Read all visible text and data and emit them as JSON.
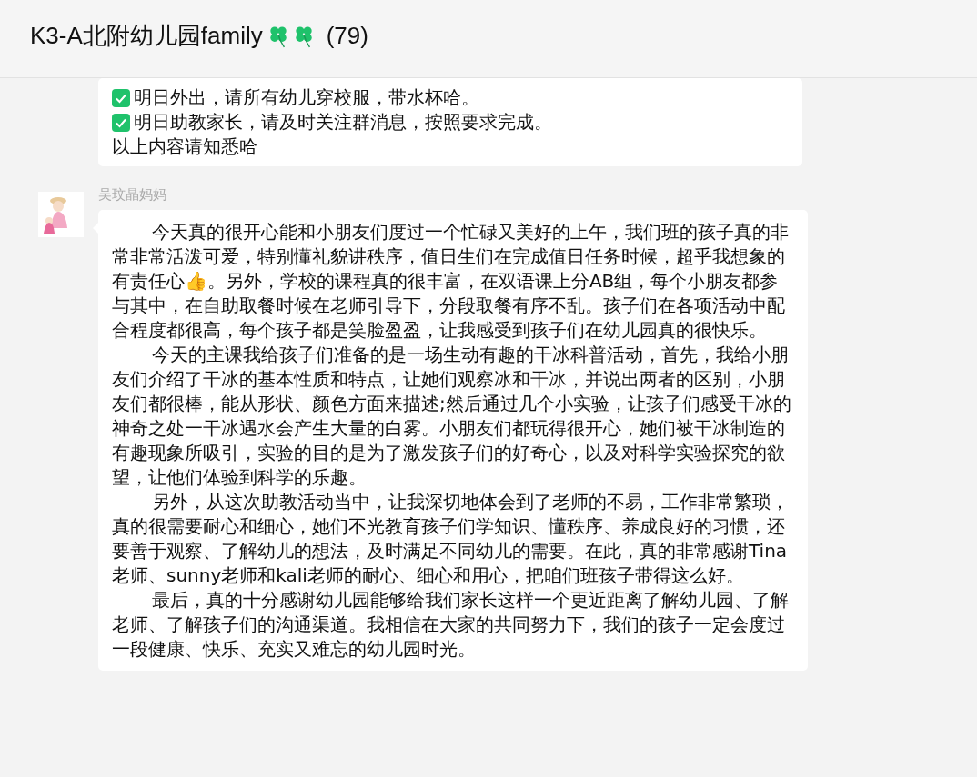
{
  "window": {
    "title": "K3-A北附幼儿园family",
    "count": "(79)"
  },
  "messages": [
    {
      "kind": "checklist",
      "lines": [
        {
          "checked": true,
          "text": "明日外出，请所有幼儿穿校服，带水杯哈。"
        },
        {
          "checked": true,
          "text": "明日助教家长，请及时关注群消息，按照要求完成。"
        }
      ],
      "footer": "以上内容请知悉哈"
    },
    {
      "kind": "paragraphs",
      "sender": "吴玟晶妈妈",
      "paragraphs": [
        {
          "parts": [
            "今天真的很开心能和小朋友们度过一个忙碌又美好的上午，我们班的孩子真的非常非常活泼可爱，特别懂礼貌讲秩序，值日生们在完成值日任务时候，超乎我想象的有责任心👍。另外，学校的课程真的很丰富，在双语课上分AB组，每个小朋友都参与其中，在自助取餐时候在老师引导下，分段取餐有序不乱。孩子们在各项活动中配合程度都很高，每个孩子都是笑脸盈盈，让我感受到孩子们在幼儿园真的很快乐。"
          ]
        },
        {
          "parts": [
            "今天的主课我给孩子们准备的是一场生动有趣的干冰科普活动，首先，我给小朋友们介绍了干冰的基本性质和特点，让她们观察冰和干冰，并说出两者的区别，小朋友们都很棒，能从形状、颜色方面来描述;然后通过几个小实验，让孩子们感受干冰的神奇之处一干冰遇水会产生大量的白雾。小朋友们都玩得很开心，她们被干冰制造的有趣现象所吸引，实验的目的是为了激发孩子们的好奇心，以及对科学实验探究的欲望，让他们体验到科学的乐趣。"
          ]
        },
        {
          "parts": [
            "另外，从这次助教活动当中，让我深切地体会到了老师的不易，工作非常繁琐，真的很需要耐心和细心，她们不光教育孩子们学知识、懂秩序、养成良好的习惯，还要善于观察、了解幼儿的想法，及时满足不同幼儿的需要。在此，真的非常感谢Tina老师、sunny老师和kali老师的耐心、细心和用心，把咱们班孩子带得这么好。"
          ]
        },
        {
          "parts": [
            "最后，真的十分感谢幼儿园能够给我们家长这样一个更近距离了解幼儿园、了解老师、了解孩子们的沟通渠道。我相信在大家的共同努力下，我们的孩子一定会度过一段健康、快乐、充实又难忘的幼儿园时光。"
          ]
        }
      ]
    }
  ]
}
